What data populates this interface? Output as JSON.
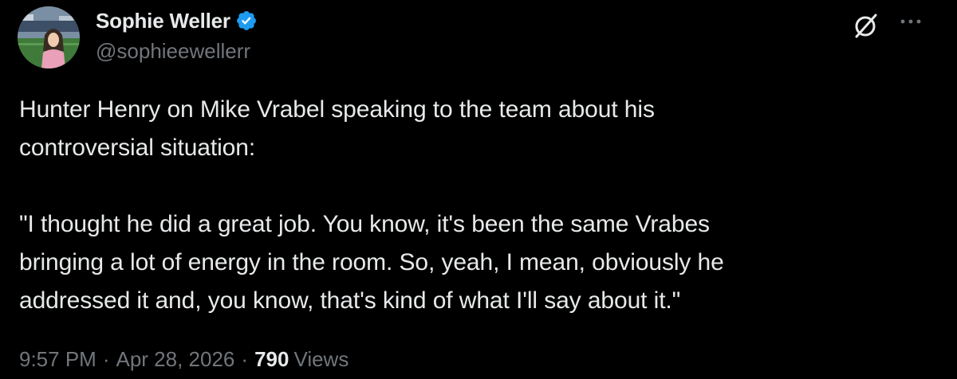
{
  "author": {
    "display_name": "Sophie Weller",
    "handle": "@sophieewellerr",
    "verified": true
  },
  "actions": {
    "grok_icon": "grok-icon",
    "more_icon": "more-options-icon"
  },
  "tweet": {
    "paragraph_1": "Hunter Henry on Mike Vrabel speaking to the team about his\ncontroversial situation:",
    "paragraph_2": "\"I thought he did a great job. You know, it's been the same Vrabes\nbringing a lot of energy in the room. So, yeah, I mean, obviously he\naddressed it and, you know, that's kind of what I'll say about it.\""
  },
  "meta": {
    "time": "9:57 PM",
    "separator": "·",
    "date": "Apr 28, 2026",
    "views_count": "790",
    "views_label": "Views"
  },
  "colors": {
    "background": "#000000",
    "primary_text": "#e7e9ea",
    "secondary_text": "#71767b",
    "verified_badge": "#1d9bf0"
  }
}
